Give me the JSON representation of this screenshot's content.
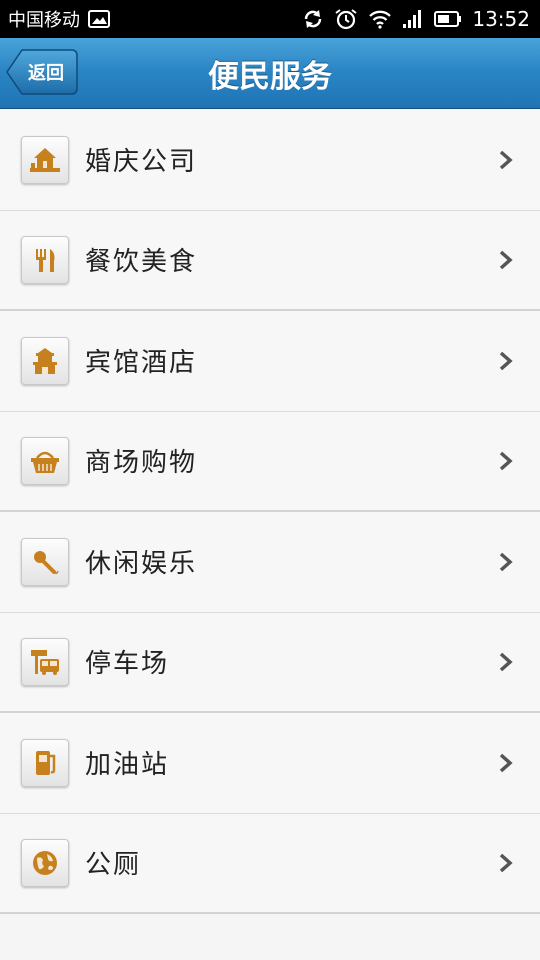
{
  "status_bar": {
    "carrier": "中国移动",
    "time": "13:52",
    "icons": [
      "image-icon",
      "sync-icon",
      "alarm-icon",
      "wifi-icon",
      "signal-icon",
      "battery-icon"
    ]
  },
  "header": {
    "back_label": "返回",
    "title": "便民服务"
  },
  "colors": {
    "header_blue": "#2b86c6",
    "icon_orange": "#c7801e",
    "text": "#222222"
  },
  "services": [
    {
      "label": "婚庆公司",
      "icon": "house-icon"
    },
    {
      "label": "餐饮美食",
      "icon": "fork-knife-icon"
    },
    {
      "label": "宾馆酒店",
      "icon": "hotel-icon"
    },
    {
      "label": "商场购物",
      "icon": "basket-icon"
    },
    {
      "label": "休闲娱乐",
      "icon": "microphone-icon"
    },
    {
      "label": "停车场",
      "icon": "bus-stop-icon"
    },
    {
      "label": "加油站",
      "icon": "fuel-pump-icon"
    },
    {
      "label": "公厕",
      "icon": "globe-icon"
    }
  ]
}
